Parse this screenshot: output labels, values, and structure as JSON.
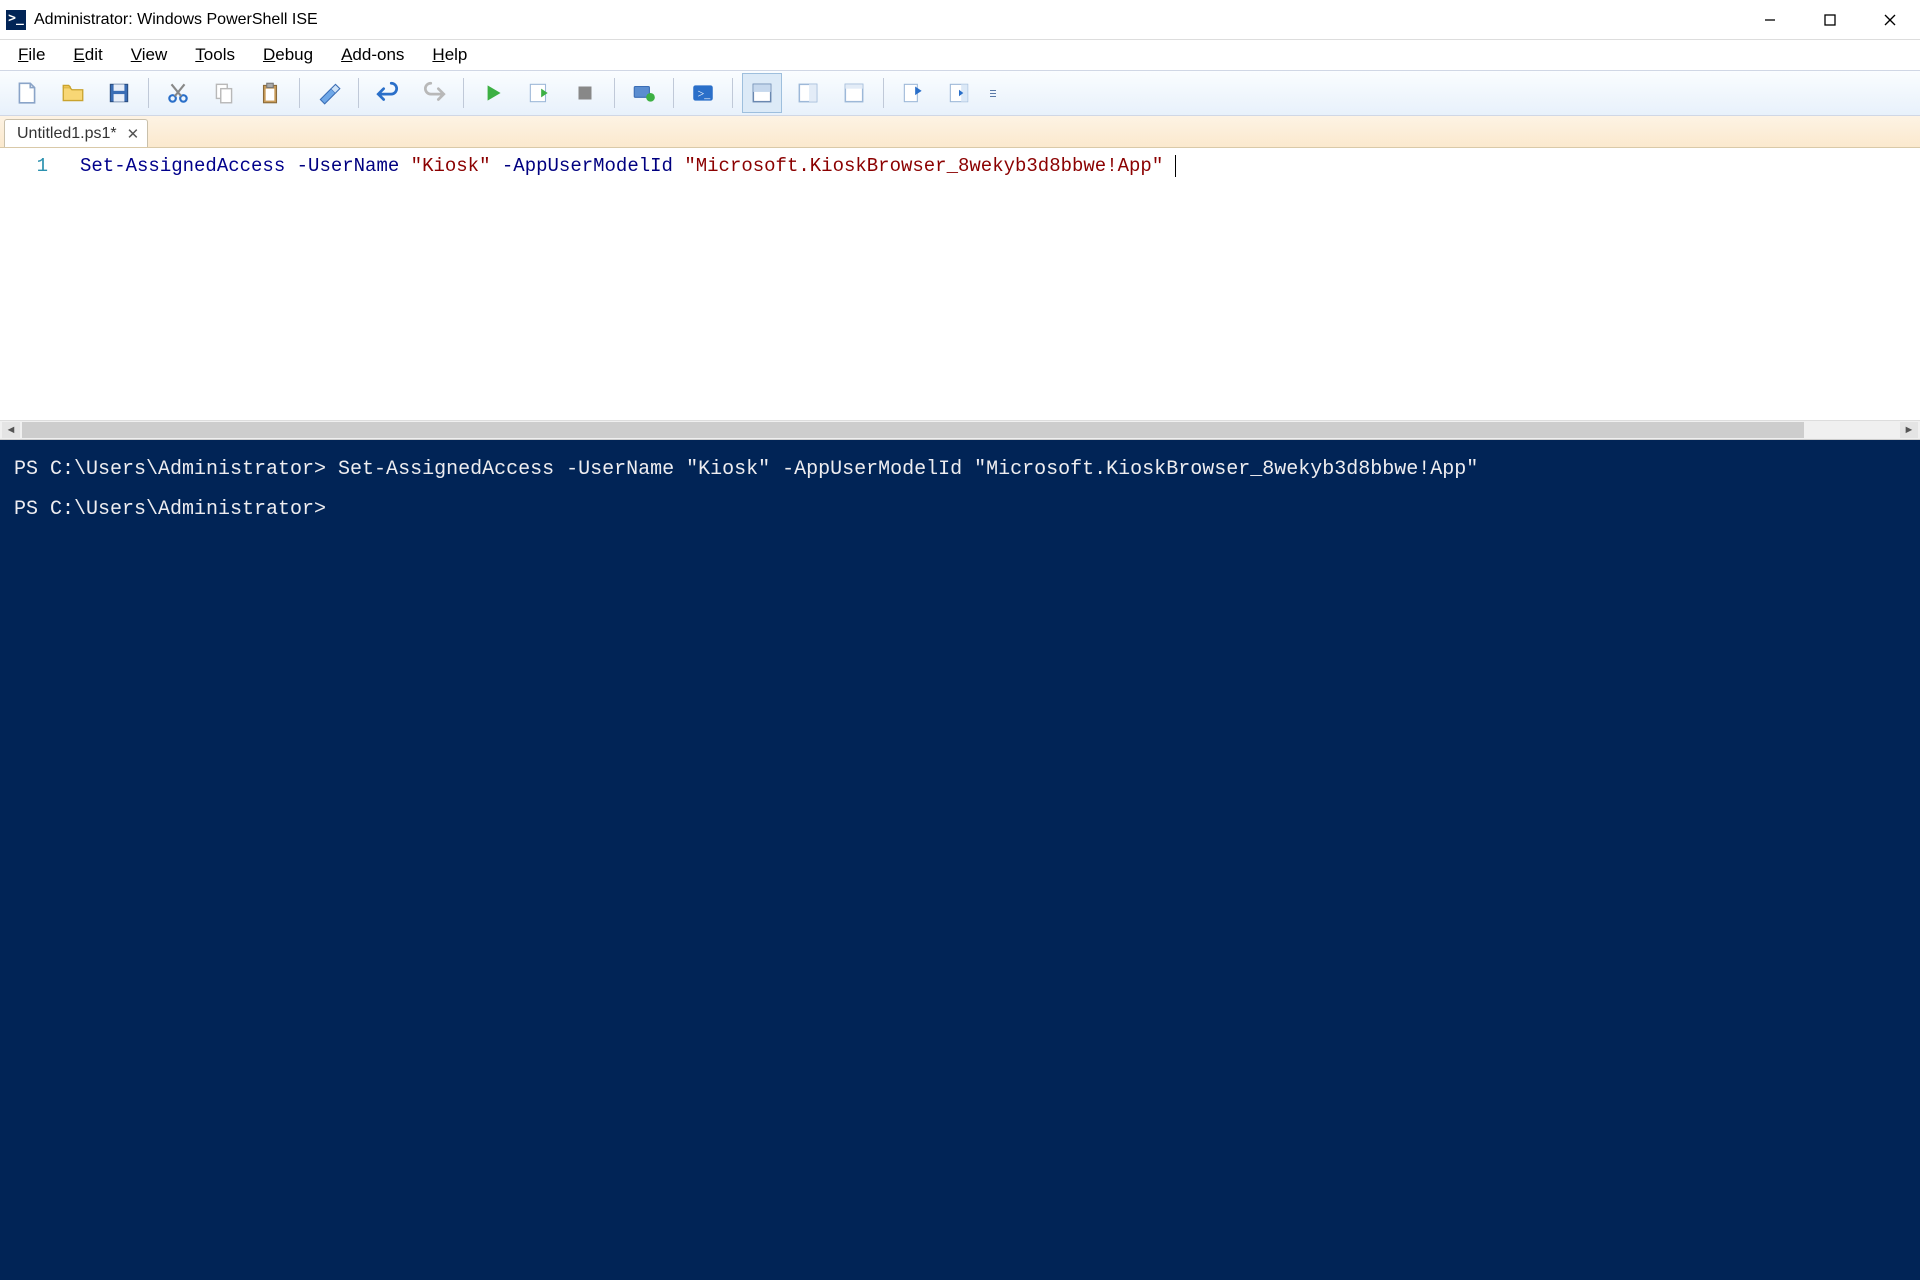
{
  "window": {
    "title": "Administrator: Windows PowerShell ISE"
  },
  "menu": {
    "file": "File",
    "edit": "Edit",
    "view": "View",
    "tools": "Tools",
    "debug": "Debug",
    "addons": "Add-ons",
    "help": "Help"
  },
  "tab": {
    "name": "Untitled1.ps1*"
  },
  "editor": {
    "line_number": "1",
    "code": {
      "cmdlet": "Set-AssignedAccess",
      "sp1": " ",
      "param1": "-UserName",
      "sp2": " ",
      "str1": "\"Kiosk\"",
      "sp3": " ",
      "param2": "-AppUserModelId",
      "sp4": " ",
      "str2": "\"Microsoft.KioskBrowser_8wekyb3d8bbwe!App\""
    }
  },
  "console": {
    "line1": "PS C:\\Users\\Administrator> Set-AssignedAccess -UserName \"Kiosk\" -AppUserModelId \"Microsoft.KioskBrowser_8wekyb3d8bbwe!App\"",
    "line2": "",
    "line3": "PS C:\\Users\\Administrator> "
  }
}
